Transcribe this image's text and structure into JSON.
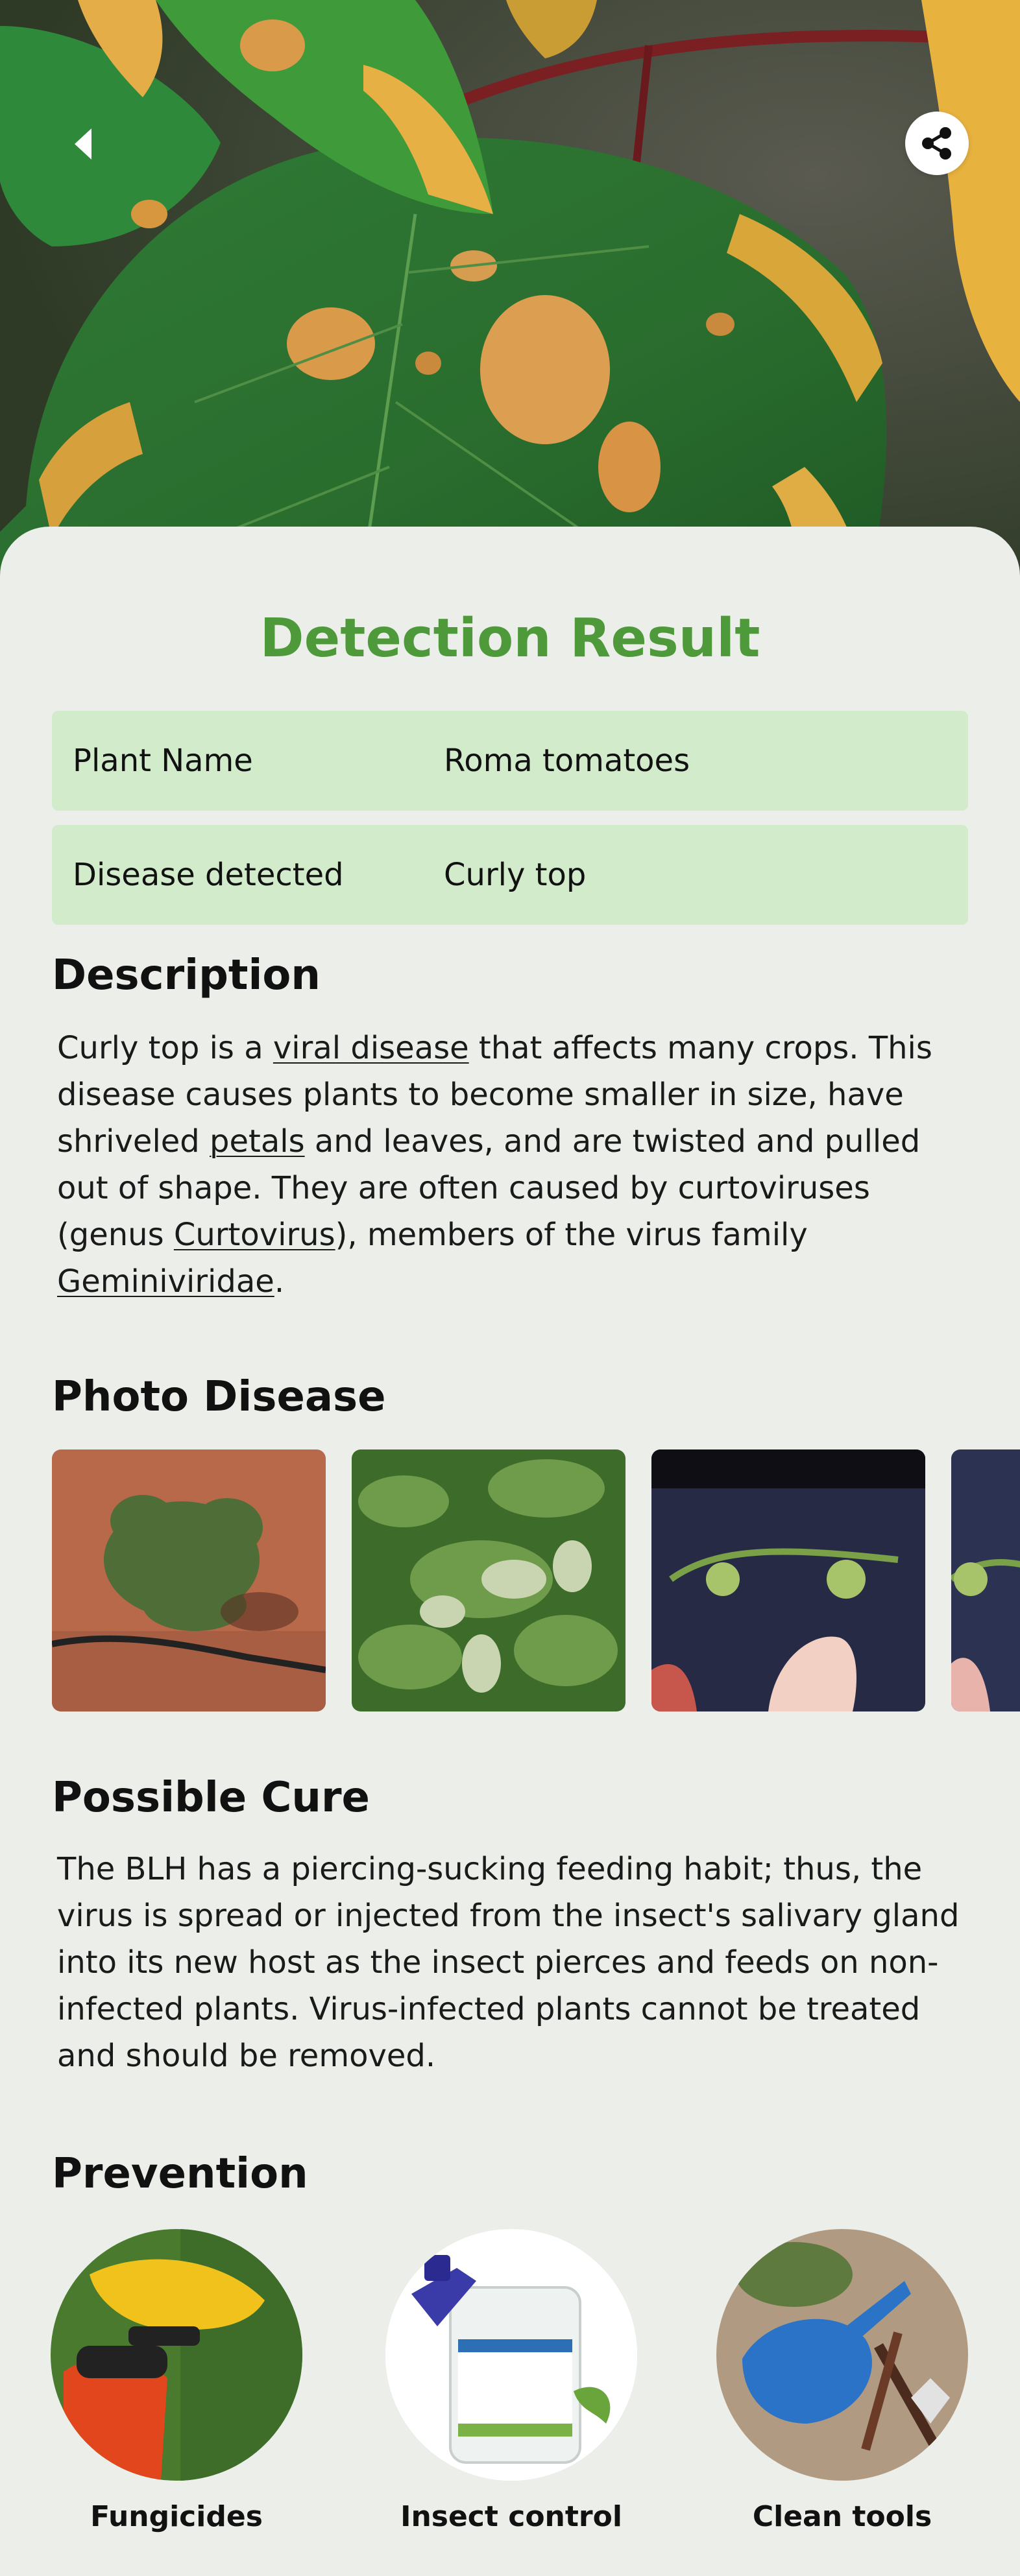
{
  "header": {
    "back_icon": "chevron-left-icon",
    "share_icon": "share-icon"
  },
  "result": {
    "title": "Detection Result",
    "plant_label": "Plant Name",
    "plant_value": "Roma tomatoes",
    "disease_label": "Disease detected",
    "disease_value": "Curly top"
  },
  "description": {
    "title": "Description",
    "parts": {
      "p1": "Curly top is a ",
      "link1": "viral disease",
      "p2": " that affects many crops. This disease causes plants to become smaller in size, have shriveled ",
      "link2": "petals",
      "p3": " and leaves, and are twisted and pulled out of shape. They are often caused by curtoviruses (genus ",
      "link3": "Curtovirus",
      "p4": "), members of the virus family ",
      "link4": "Geminiviridae",
      "p5": "."
    }
  },
  "photos": {
    "title": "Photo Disease"
  },
  "cure": {
    "title": "Possible Cure",
    "text": "The BLH has a piercing-sucking feeding habit; thus, the virus is spread or injected from the insect's salivary gland into its new host as the insect pierces and feeds on non-infected plants. Virus-infected plants cannot be treated and should be removed."
  },
  "prevention": {
    "title": "Prevention",
    "items": [
      {
        "label": "Fungicides"
      },
      {
        "label": "Insect control"
      },
      {
        "label": "Clean tools"
      }
    ]
  },
  "colors": {
    "accent": "#4e9a3a",
    "row_bg": "#d2ebcb",
    "page_bg": "#ebeee9"
  }
}
